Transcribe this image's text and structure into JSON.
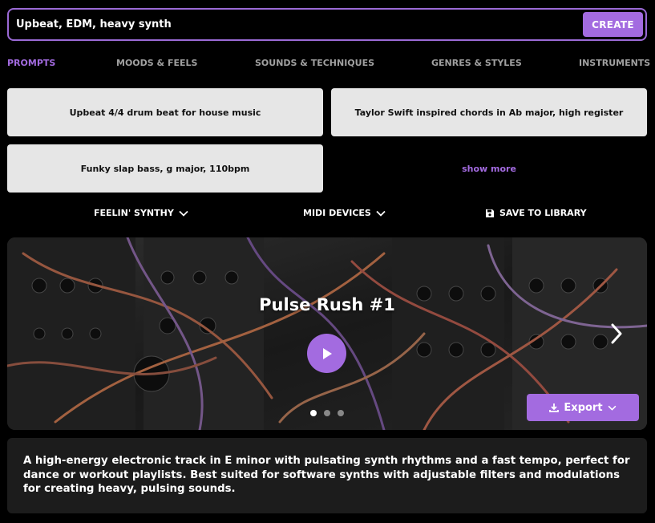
{
  "search": {
    "value": "Upbeat, EDM, heavy synth",
    "create_label": "CREATE"
  },
  "tabs": [
    {
      "label": "PROMPTS",
      "active": true
    },
    {
      "label": "MOODS & FEELS",
      "active": false
    },
    {
      "label": "SOUNDS & TECHNIQUES",
      "active": false
    },
    {
      "label": "GENRES & STYLES",
      "active": false
    },
    {
      "label": "INSTRUMENTS",
      "active": false
    }
  ],
  "prompts": [
    "Upbeat 4/4 drum beat for house music",
    "Taylor Swift inspired chords in Ab major, high register",
    "Funky slap bass, g major, 110bpm"
  ],
  "show_more_label": "show more",
  "options": {
    "preset_label": "FEELIN' SYNTHY",
    "midi_label": "MIDI DEVICES",
    "save_label": "SAVE TO LIBRARY"
  },
  "track": {
    "title": "Pulse Rush #1",
    "export_label": "Export",
    "slide_count": 3,
    "active_slide": 0,
    "description": "A high-energy electronic track in E minor with pulsating synth rhythms and a fast tempo, perfect for dance or workout playlists. Best suited for software synths with adjustable filters and modulations for creating heavy, pulsing sounds."
  },
  "colors": {
    "accent": "#a36be0",
    "card": "#e6e6e6",
    "panel": "#1c1c1c"
  },
  "icons": [
    "chevron-down-icon",
    "save-icon",
    "play-icon",
    "chevron-right-icon",
    "download-icon"
  ]
}
